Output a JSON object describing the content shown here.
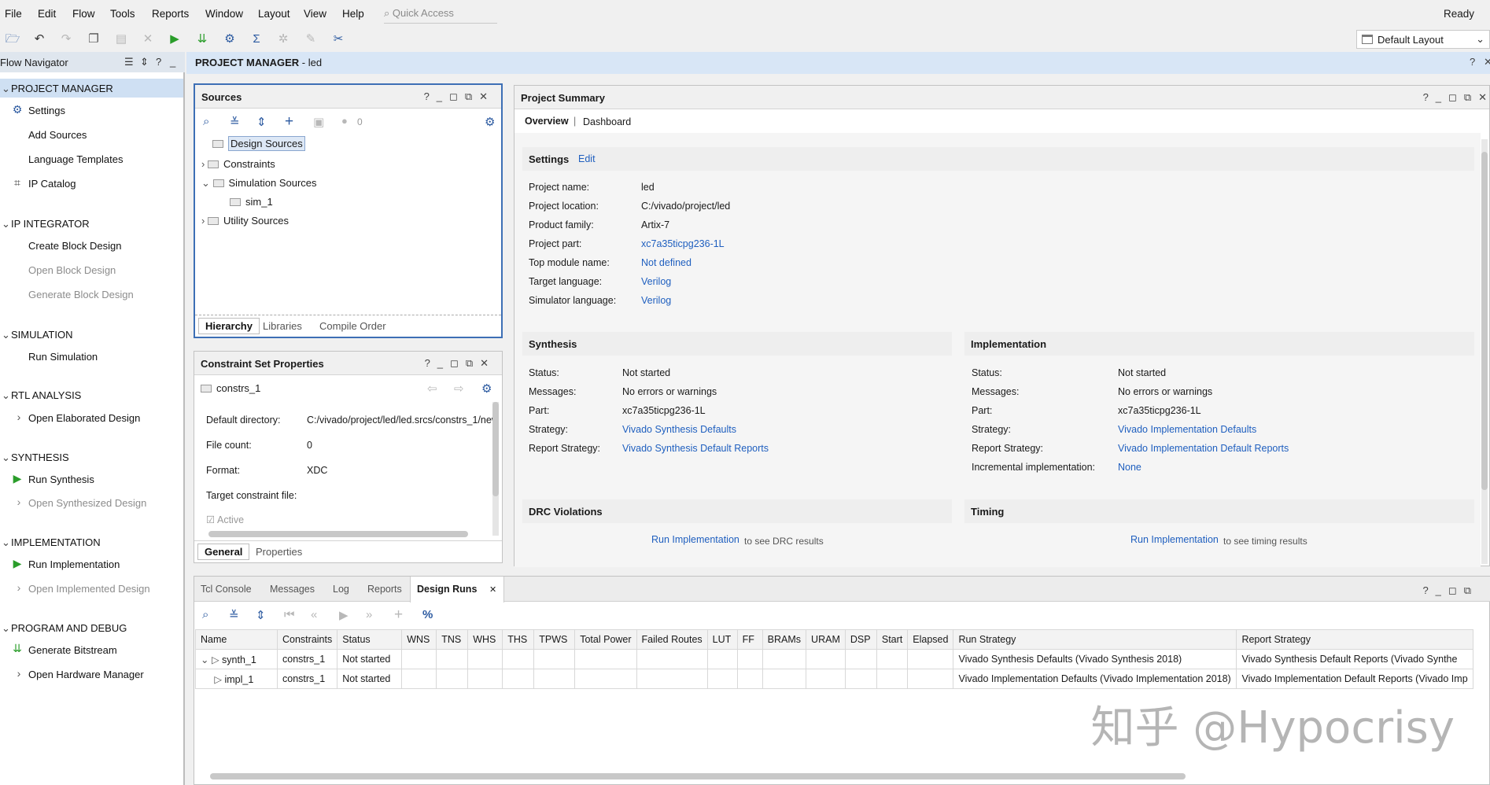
{
  "menu": [
    "File",
    "Edit",
    "Flow",
    "Tools",
    "Reports",
    "Window",
    "Layout",
    "View",
    "Help"
  ],
  "quick_access_placeholder": "Quick Access",
  "status": "Ready",
  "layout_select": "Default Layout",
  "flow_navigator": {
    "title": "Flow Navigator",
    "sections": [
      {
        "label": "PROJECT MANAGER",
        "items": [
          "Settings",
          "Add Sources",
          "Language Templates",
          "IP Catalog"
        ]
      },
      {
        "label": "IP INTEGRATOR",
        "items": [
          "Create Block Design",
          "Open Block Design",
          "Generate Block Design"
        ]
      },
      {
        "label": "SIMULATION",
        "items": [
          "Run Simulation"
        ]
      },
      {
        "label": "RTL ANALYSIS",
        "items": [
          "Open Elaborated Design"
        ]
      },
      {
        "label": "SYNTHESIS",
        "items": [
          "Run Synthesis",
          "Open Synthesized Design"
        ]
      },
      {
        "label": "IMPLEMENTATION",
        "items": [
          "Run Implementation",
          "Open Implemented Design"
        ]
      },
      {
        "label": "PROGRAM AND DEBUG",
        "items": [
          "Generate Bitstream",
          "Open Hardware Manager"
        ]
      }
    ]
  },
  "pm_bar": {
    "bold": "PROJECT MANAGER",
    "rest": " - led"
  },
  "sources": {
    "title": "Sources",
    "count": "0",
    "tree": [
      "Design Sources",
      "Constraints",
      "Simulation Sources",
      "sim_1",
      "Utility Sources"
    ],
    "tabs": [
      "Hierarchy",
      "Libraries",
      "Compile Order"
    ]
  },
  "constraint_props": {
    "title": "Constraint Set Properties",
    "name": "constrs_1",
    "rows": [
      {
        "label": "Default directory:",
        "value": "C:/vivado/project/led/led.srcs/constrs_1/new"
      },
      {
        "label": "File count:",
        "value": "0"
      },
      {
        "label": "Format:",
        "value": "XDC"
      },
      {
        "label": "Target constraint file:",
        "value": ""
      }
    ],
    "active_label": "Active",
    "tabs": [
      "General",
      "Properties"
    ]
  },
  "summary": {
    "title": "Project Summary",
    "tabs": [
      "Overview",
      "Dashboard"
    ],
    "settings_label": "Settings",
    "edit_label": "Edit",
    "settings": [
      {
        "label": "Project name:",
        "value": "led"
      },
      {
        "label": "Project location:",
        "value": "C:/vivado/project/led"
      },
      {
        "label": "Product family:",
        "value": "Artix-7"
      },
      {
        "label": "Project part:",
        "value": "xc7a35ticpg236-1L"
      },
      {
        "label": "Top module name:",
        "value": "Not defined"
      },
      {
        "label": "Target language:",
        "value": "Verilog"
      },
      {
        "label": "Simulator language:",
        "value": "Verilog"
      }
    ],
    "synthesis_label": "Synthesis",
    "synthesis": [
      {
        "label": "Status:",
        "value": "Not started"
      },
      {
        "label": "Messages:",
        "value": "No errors or warnings"
      },
      {
        "label": "Part:",
        "value": "xc7a35ticpg236-1L"
      },
      {
        "label": "Strategy:",
        "value": "Vivado Synthesis Defaults"
      },
      {
        "label": "Report Strategy:",
        "value": "Vivado Synthesis Default Reports"
      }
    ],
    "implementation_label": "Implementation",
    "implementation": [
      {
        "label": "Status:",
        "value": "Not started"
      },
      {
        "label": "Messages:",
        "value": "No errors or warnings"
      },
      {
        "label": "Part:",
        "value": "xc7a35ticpg236-1L"
      },
      {
        "label": "Strategy:",
        "value": "Vivado Implementation Defaults"
      },
      {
        "label": "Report Strategy:",
        "value": "Vivado Implementation Default Reports"
      },
      {
        "label": "Incremental implementation:",
        "value": "None"
      }
    ],
    "drc_label": "DRC Violations",
    "drc_link": "Run Implementation",
    "drc_text": "to see DRC results",
    "timing_label": "Timing",
    "timing_link": "Run Implementation",
    "timing_text": "to see timing results"
  },
  "bottom": {
    "tabs": [
      "Tcl Console",
      "Messages",
      "Log",
      "Reports",
      "Design Runs"
    ],
    "columns": [
      "Name",
      "Constraints",
      "Status",
      "WNS",
      "TNS",
      "WHS",
      "THS",
      "TPWS",
      "Total Power",
      "Failed Routes",
      "LUT",
      "FF",
      "BRAMs",
      "URAM",
      "DSP",
      "Start",
      "Elapsed",
      "Run Strategy",
      "Report Strategy"
    ],
    "rows": [
      {
        "name": "synth_1",
        "constraints": "constrs_1",
        "status": "Not started",
        "run_strategy": "Vivado Synthesis Defaults (Vivado Synthesis 2018)",
        "report_strategy": "Vivado Synthesis Default Reports (Vivado Synthe"
      },
      {
        "name": "impl_1",
        "constraints": "constrs_1",
        "status": "Not started",
        "run_strategy": "Vivado Implementation Defaults (Vivado Implementation 2018)",
        "report_strategy": "Vivado Implementation Default Reports (Vivado Imp"
      }
    ]
  },
  "watermark": "知乎 @Hypocrisy"
}
